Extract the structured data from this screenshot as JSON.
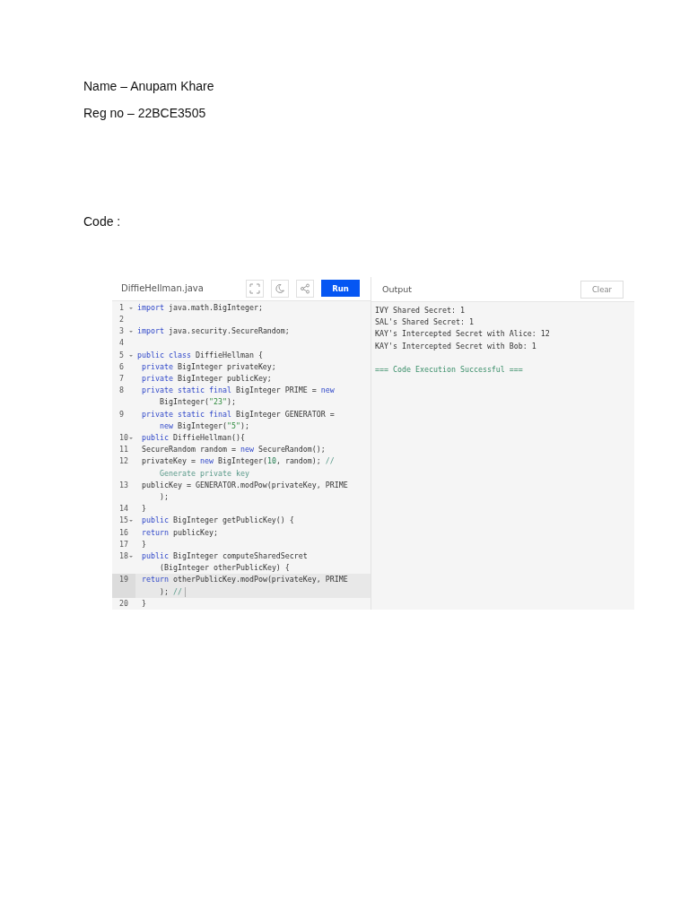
{
  "document": {
    "name_line": "Name – Anupam Khare",
    "reg_line": "Reg no – 22BCE3505",
    "code_heading": "Code :"
  },
  "editor": {
    "file_name": "DiffieHellman.java",
    "run_label": "Run",
    "lines": [
      {
        "number": "1",
        "foldable": true,
        "indented": false,
        "current": false,
        "parts": [
          {
            "tokens": [
              {
                "kind": "kw",
                "text": "import"
              },
              {
                "kind": "plain",
                "text": " java.math.BigInteger;"
              }
            ]
          }
        ]
      },
      {
        "number": "2",
        "foldable": false,
        "current": false
      },
      {
        "number": "3",
        "foldable": true,
        "indented": false,
        "current": false,
        "parts": [
          {
            "tokens": [
              {
                "kind": "kw",
                "text": "import"
              },
              {
                "kind": "plain",
                "text": " java.security.SecureRandom;"
              }
            ]
          }
        ]
      },
      {
        "number": "4",
        "foldable": false,
        "current": false
      },
      {
        "number": "5",
        "foldable": true,
        "indented": false,
        "current": false,
        "parts": [
          {
            "tokens": [
              {
                "kind": "kw",
                "text": "public class"
              },
              {
                "kind": "plain",
                "text": " DiffieHellman {"
              }
            ]
          }
        ]
      },
      {
        "number": "6",
        "foldable": false,
        "indented": true,
        "current": false,
        "parts": [
          {
            "tokens": [
              {
                "kind": "kw",
                "text": "private"
              },
              {
                "kind": "plain",
                "text": " BigInteger privateKey;"
              }
            ]
          }
        ]
      },
      {
        "number": "7",
        "foldable": false,
        "indented": true,
        "current": false,
        "parts": [
          {
            "tokens": [
              {
                "kind": "kw",
                "text": "private"
              },
              {
                "kind": "plain",
                "text": " BigInteger publicKey;"
              }
            ]
          }
        ]
      },
      {
        "number": "8",
        "foldable": false,
        "indented": true,
        "current": false,
        "parts": [
          {
            "tokens": [
              {
                "kind": "kw",
                "text": "private static final"
              },
              {
                "kind": "plain",
                "text": " BigInteger PRIME = "
              },
              {
                "kind": "kw",
                "text": "new"
              }
            ]
          },
          {
            "tokens": [
              {
                "kind": "plain",
                "text": "BigInteger("
              },
              {
                "kind": "str",
                "text": "\"23\""
              },
              {
                "kind": "plain",
                "text": ");"
              }
            ]
          }
        ]
      },
      {
        "number": "9",
        "foldable": false,
        "indented": true,
        "current": false,
        "parts": [
          {
            "tokens": [
              {
                "kind": "kw",
                "text": "private static final"
              },
              {
                "kind": "plain",
                "text": " BigInteger GENERATOR ="
              }
            ]
          },
          {
            "tokens": [
              {
                "kind": "kw",
                "text": "new"
              },
              {
                "kind": "plain",
                "text": " BigInteger("
              },
              {
                "kind": "str",
                "text": "\"5\""
              },
              {
                "kind": "plain",
                "text": ");"
              }
            ]
          }
        ]
      },
      {
        "number": "10",
        "foldable": true,
        "indented": true,
        "current": false,
        "parts": [
          {
            "tokens": [
              {
                "kind": "kw",
                "text": "public"
              },
              {
                "kind": "plain",
                "text": " DiffieHellman(){"
              }
            ]
          }
        ]
      },
      {
        "number": "11",
        "foldable": false,
        "indented": true,
        "current": false,
        "parts": [
          {
            "tokens": [
              {
                "kind": "plain",
                "text": "SecureRandom random = "
              },
              {
                "kind": "kw",
                "text": "new"
              },
              {
                "kind": "plain",
                "text": " SecureRandom();"
              }
            ]
          }
        ]
      },
      {
        "number": "12",
        "foldable": false,
        "indented": true,
        "current": false,
        "parts": [
          {
            "tokens": [
              {
                "kind": "plain",
                "text": "privateKey = "
              },
              {
                "kind": "kw",
                "text": "new"
              },
              {
                "kind": "plain",
                "text": " BigInteger("
              },
              {
                "kind": "num",
                "text": "10"
              },
              {
                "kind": "plain",
                "text": ", random); "
              },
              {
                "kind": "comment",
                "text": "//"
              }
            ]
          },
          {
            "tokens": [
              {
                "kind": "comment",
                "text": "Generate private key"
              }
            ]
          }
        ]
      },
      {
        "number": "13",
        "foldable": false,
        "indented": true,
        "current": false,
        "parts": [
          {
            "tokens": [
              {
                "kind": "plain",
                "text": "publicKey = GENERATOR.modPow(privateKey, PRIME"
              }
            ]
          },
          {
            "tokens": [
              {
                "kind": "plain",
                "text": ");"
              }
            ]
          }
        ]
      },
      {
        "number": "14",
        "foldable": false,
        "indented": true,
        "current": false,
        "parts": [
          {
            "tokens": [
              {
                "kind": "plain",
                "text": "}"
              }
            ]
          }
        ]
      },
      {
        "number": "15",
        "foldable": true,
        "indented": true,
        "current": false,
        "parts": [
          {
            "tokens": [
              {
                "kind": "kw",
                "text": "public"
              },
              {
                "kind": "plain",
                "text": " BigInteger getPublicKey() {"
              }
            ]
          }
        ]
      },
      {
        "number": "16",
        "foldable": false,
        "indented": true,
        "current": false,
        "parts": [
          {
            "tokens": [
              {
                "kind": "kw",
                "text": "return"
              },
              {
                "kind": "plain",
                "text": " publicKey;"
              }
            ]
          }
        ]
      },
      {
        "number": "17",
        "foldable": false,
        "indented": true,
        "current": false,
        "parts": [
          {
            "tokens": [
              {
                "kind": "plain",
                "text": "}"
              }
            ]
          }
        ]
      },
      {
        "number": "18",
        "foldable": true,
        "indented": true,
        "current": false,
        "parts": [
          {
            "tokens": [
              {
                "kind": "kw",
                "text": "public"
              },
              {
                "kind": "plain",
                "text": " BigInteger computeSharedSecret"
              }
            ]
          },
          {
            "tokens": [
              {
                "kind": "plain",
                "text": "(BigInteger otherPublicKey) {"
              }
            ]
          }
        ]
      },
      {
        "number": "19",
        "foldable": false,
        "indented": true,
        "current": true,
        "parts": [
          {
            "tokens": [
              {
                "kind": "kw",
                "text": "return"
              },
              {
                "kind": "plain",
                "text": " otherPublicKey.modPow(privateKey, PRIME"
              }
            ]
          },
          {
            "tokens": [
              {
                "kind": "plain",
                "text": "); "
              },
              {
                "kind": "comment",
                "text": "//"
              }
            ]
          }
        ]
      },
      {
        "number": "20",
        "foldable": false,
        "indented": true,
        "current": false,
        "parts": [
          {
            "tokens": [
              {
                "kind": "plain",
                "text": "}"
              }
            ]
          }
        ]
      }
    ]
  },
  "output": {
    "title": "Output",
    "clear_label": "Clear",
    "lines": [
      {
        "kind": "plain",
        "text": "IVY Shared Secret: 1"
      },
      {
        "kind": "plain",
        "text": "SAL's Shared Secret: 1"
      },
      {
        "kind": "plain",
        "text": "KAY's Intercepted Secret with Alice: 12"
      },
      {
        "kind": "plain",
        "text": "KAY's Intercepted Secret with Bob: 1"
      },
      {
        "kind": "blank"
      },
      {
        "kind": "success",
        "text": "=== Code Execution Successful ==="
      }
    ]
  }
}
